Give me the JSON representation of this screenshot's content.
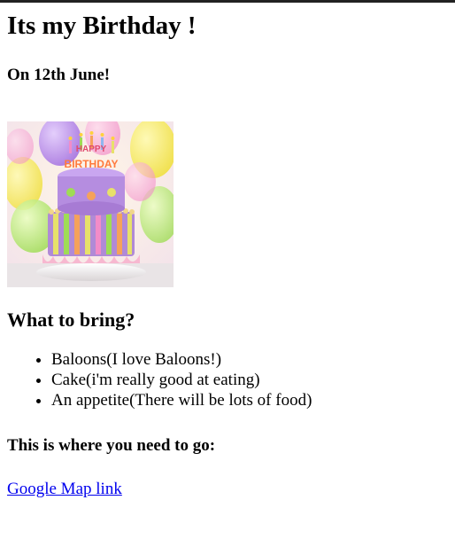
{
  "page": {
    "title": "Its my Birthday !",
    "date_heading": "On 12th June!"
  },
  "image": {
    "cake_lettering": "HAPPY BIRTHDAY",
    "description_icon": "birthday-cake-photo-icon"
  },
  "bring": {
    "heading": "What to bring?",
    "items": [
      "Baloons(I love Baloons!)",
      "Cake(i'm really good at eating)",
      "An appetite(There will be lots of food)"
    ]
  },
  "location": {
    "heading": "This is where you need to go:",
    "link_text": "Google Map link"
  },
  "colors": {
    "link": "#0000ee",
    "text": "#000000",
    "background": "#ffffff"
  }
}
